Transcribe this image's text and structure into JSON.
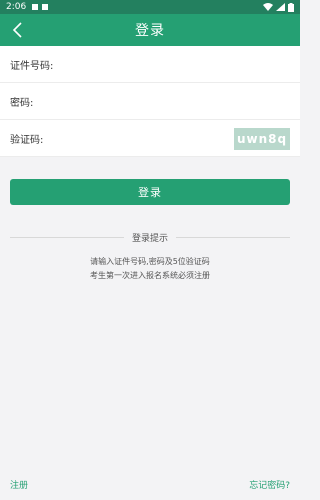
{
  "status_bar": {
    "time": "2:06"
  },
  "header": {
    "title": "登录"
  },
  "form": {
    "id_label": "证件号码:",
    "id_value": "",
    "password_label": "密码:",
    "password_value": "",
    "captcha_label": "验证码:",
    "captcha_value": "",
    "captcha_image_text": "uwn8q"
  },
  "login_button": {
    "label": "登录"
  },
  "tips": {
    "heading": "登录提示",
    "line1": "请输入证件号码,密码及5位验证码",
    "line2": "考生第一次进入报名系统必须注册"
  },
  "footer": {
    "register_label": "注册",
    "forgot_label": "忘记密码?"
  },
  "colors": {
    "primary": "#25a073",
    "status_bar": "#23805f",
    "captcha_bg": "#b9d8cc",
    "background": "#f3f3f5"
  },
  "icons": {
    "back": "back-arrow-icon",
    "wifi": "wifi-icon",
    "signal": "signal-icon",
    "battery": "battery-icon"
  }
}
